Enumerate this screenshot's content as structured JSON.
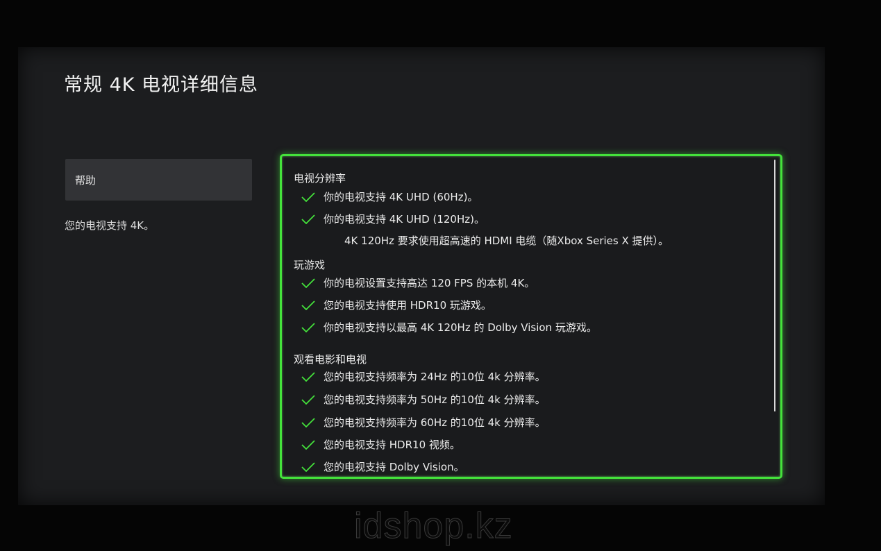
{
  "page": {
    "title": "常规 4K 电视详细信息"
  },
  "sidebar": {
    "help_label": "帮助",
    "support_note": "您的电视支持 4K。"
  },
  "details": {
    "sections": [
      {
        "heading": "电视分辨率",
        "items": [
          {
            "text": "你的电视支持 4K UHD (60Hz)。",
            "checked": true
          },
          {
            "text": "你的电视支持 4K UHD (120Hz)。",
            "checked": true
          }
        ],
        "note": "4K 120Hz 要求使用超高速的 HDMI 电缆（随Xbox Series X 提供）。"
      },
      {
        "heading": "玩游戏",
        "items": [
          {
            "text": "你的电视设置支持高达 120 FPS 的本机 4K。",
            "checked": true
          },
          {
            "text": "您的电视支持使用 HDR10 玩游戏。",
            "checked": true
          },
          {
            "text": "你的电视支持以最高 4K 120Hz 的 Dolby Vision 玩游戏。",
            "checked": true
          }
        ]
      },
      {
        "heading": "观看电影和电视",
        "items": [
          {
            "text": "您的电视支持频率为 24Hz 的10位 4k 分辨率。",
            "checked": true
          },
          {
            "text": "您的电视支持频率为 50Hz 的10位 4k 分辨率。",
            "checked": true
          },
          {
            "text": "您的电视支持频率为 60Hz 的10位 4k 分辨率。",
            "checked": true
          },
          {
            "text": "您的电视支持 HDR10 视频。",
            "checked": true
          },
          {
            "text": "您的电视支持 Dolby Vision。",
            "checked": true
          }
        ]
      }
    ]
  },
  "watermark": "idshop.kz",
  "colors": {
    "accent": "#44e23b",
    "background": "#1c1d1f",
    "button": "#323336",
    "text": "#ececec"
  },
  "icons": {
    "check": "check-icon"
  }
}
